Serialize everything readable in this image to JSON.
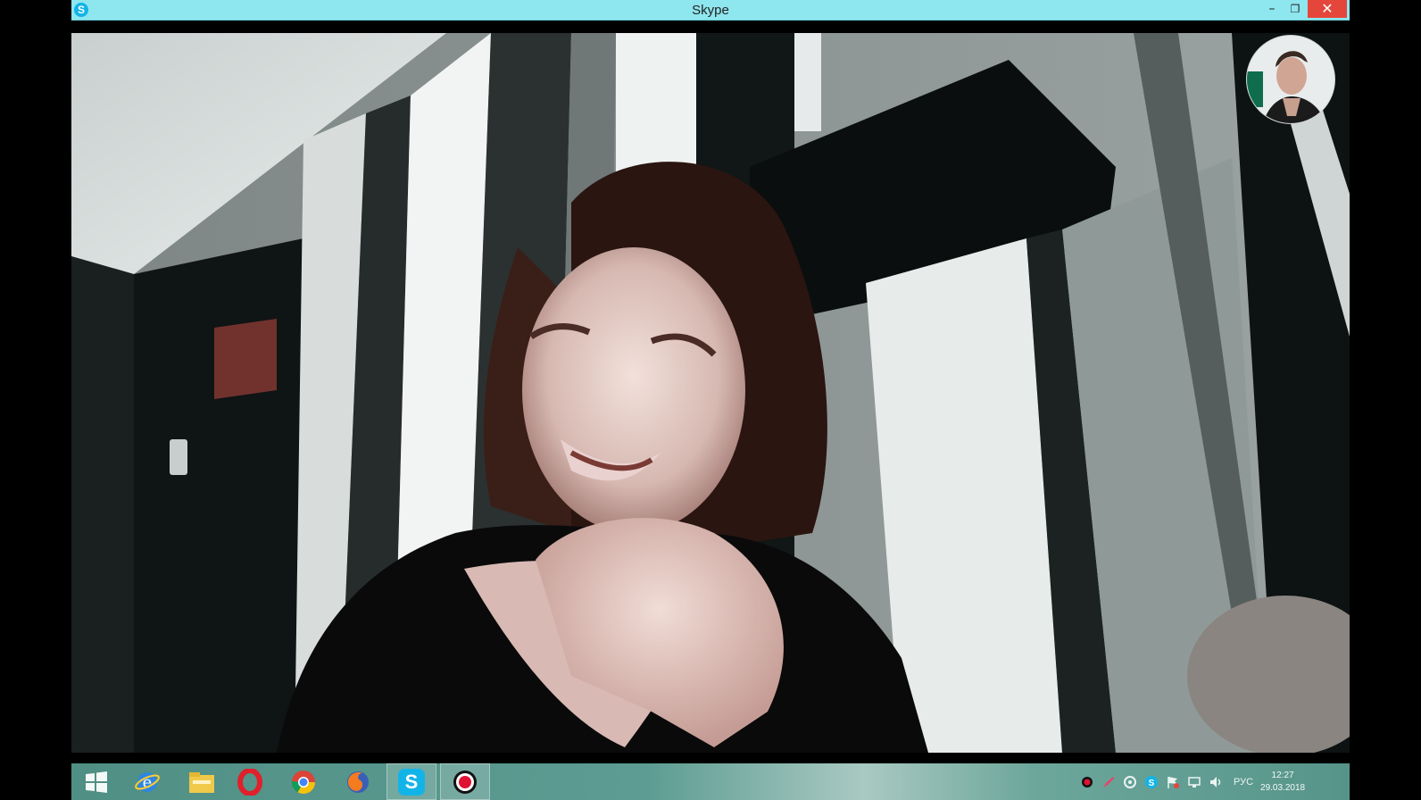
{
  "window": {
    "title": "Skype",
    "icon": "skype-icon",
    "minimize_glyph": "–",
    "restore_glyph": "❐",
    "close_glyph": "✕"
  },
  "call": {
    "remote_video": "remote-video-feed",
    "self_view": "self-view-video"
  },
  "taskbar": {
    "start_icon": "windows-start-icon",
    "pinned": [
      {
        "name": "internet-explorer-icon"
      },
      {
        "name": "file-explorer-icon"
      },
      {
        "name": "opera-icon"
      },
      {
        "name": "chrome-icon"
      },
      {
        "name": "firefox-icon"
      },
      {
        "name": "skype-taskbar-icon",
        "letter": "S",
        "active": true
      },
      {
        "name": "screen-recorder-icon"
      }
    ],
    "tray": {
      "icons": [
        "record-icon",
        "pen-icon",
        "update-icon",
        "skype-tray-icon",
        "flag-icon",
        "network-icon",
        "volume-icon"
      ],
      "language": "РУС",
      "time": "12:27",
      "date": "29.03.2018"
    }
  },
  "colors": {
    "titlebar": "#8ee6ee",
    "close": "#e4463c",
    "skype_blue": "#12b4e8",
    "taskbar": "#5c9c92"
  }
}
